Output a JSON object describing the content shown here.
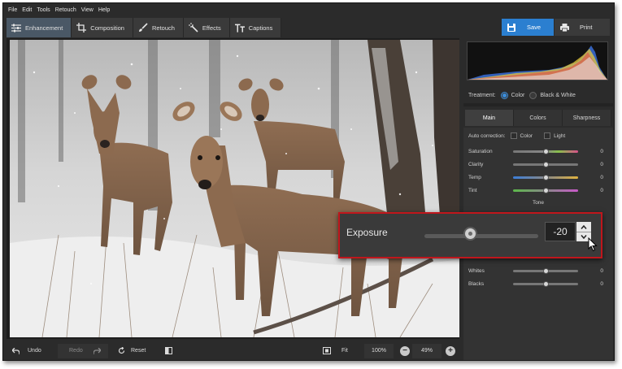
{
  "menu": [
    "File",
    "Edit",
    "Tools",
    "Retouch",
    "View",
    "Help"
  ],
  "tabs": [
    {
      "label": "Enhancement",
      "icon": "sliders-icon",
      "active": true
    },
    {
      "label": "Composition",
      "icon": "crop-icon",
      "active": false
    },
    {
      "label": "Retouch",
      "icon": "brush-icon",
      "active": false
    },
    {
      "label": "Effects",
      "icon": "magic-wand-icon",
      "active": false
    },
    {
      "label": "Captions",
      "icon": "text-icon",
      "active": false
    }
  ],
  "actions": {
    "save": "Save",
    "print": "Print"
  },
  "colors": {
    "accent": "#2b7fd0",
    "highlight": "#c0161c",
    "background": "#2b2b2b"
  },
  "treatment": {
    "label": "Treatment:",
    "options": [
      "Color",
      "Black & White"
    ],
    "selected": "Color"
  },
  "panel_tabs": [
    "Main",
    "Colors",
    "Sharpness"
  ],
  "auto_correction": {
    "label": "Auto correction:",
    "options": [
      "Color",
      "Light"
    ]
  },
  "adjustments": [
    {
      "name": "Saturation",
      "value": "0"
    },
    {
      "name": "Clarity",
      "value": "0"
    },
    {
      "name": "Temp",
      "value": "0"
    },
    {
      "name": "Tint",
      "value": "0"
    }
  ],
  "tone_section": "Tone",
  "tone_adjustments": [
    {
      "name": "Whites",
      "value": "0"
    },
    {
      "name": "Blacks",
      "value": "0"
    }
  ],
  "exposure": {
    "label": "Exposure",
    "value": "-20"
  },
  "bottom": {
    "undo": "Undo",
    "redo": "Redo",
    "reset": "Reset",
    "fit": "Fit",
    "zoom_100": "100%",
    "zoom_level": "49%"
  }
}
